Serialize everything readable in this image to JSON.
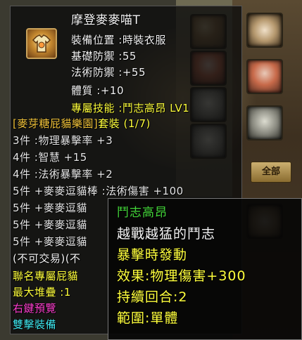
{
  "item": {
    "name": "摩登麥麥喵T",
    "slot_label": "裝備位置",
    "slot_value": "時裝衣服",
    "base_def_label": "基礎防禦",
    "base_def_value": "55",
    "magic_def_label": "法術防禦",
    "magic_def_value": "+55",
    "con_label": "體質",
    "con_value": "+10",
    "skill_label": "專屬技能",
    "skill_value": "鬥志高昂  LV1",
    "set_name": "[麥芽糖屁貓樂園]",
    "set_label": "套裝",
    "set_progress": "(1/7)",
    "set_bonuses": [
      "3件 :物理暴擊率 +3",
      "4件 :智慧 +15",
      "4件 :法術暴擊率 +2",
      "5件 +麥麥逗貓棒 :法術傷害 +100",
      "5件 +麥麥逗貓",
      "5件 +麥麥逗貓",
      "5件 +麥麥逗貓"
    ],
    "trade": "(不可交易)(不",
    "exclusive": "聯名專屬屁貓",
    "max_stack": "最大堆疊 :1",
    "right_preview": "右鍵預覽",
    "double_equip": "雙擊裝備"
  },
  "skill_tooltip": {
    "name": "鬥志高昂",
    "desc": "越戰越猛的鬥志",
    "trigger": "暴擊時發動",
    "effect": "效果:物理傷害+300",
    "duration": "持續回合:2",
    "range": "範圍:單體"
  },
  "background": {
    "button_label": "全部",
    "hidden_text": "LV"
  },
  "colors": {
    "white": "#f4f4f4",
    "yellow": "#ffff3c",
    "gold": "#f0c23a",
    "pink": "#ff3fd0",
    "cyan": "#3fe8f0",
    "skill_name": "#44d83a"
  }
}
